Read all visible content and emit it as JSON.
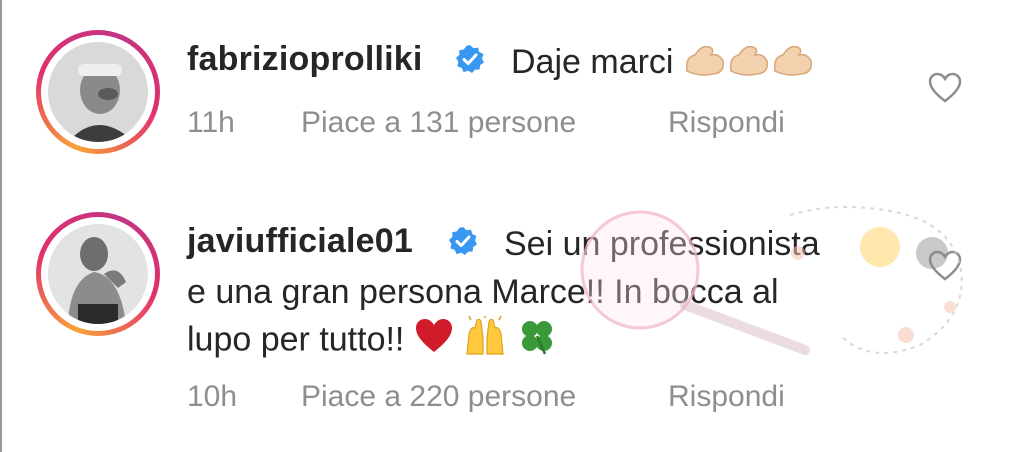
{
  "comments": [
    {
      "username": "fabrizioprolliki",
      "verified": true,
      "text": "Daje marci",
      "emojis": [
        "flexed-biceps-emoji",
        "flexed-biceps-emoji",
        "flexed-biceps-emoji"
      ],
      "time": "11h",
      "likes": "Piace a 131 persone",
      "reply": "Rispondi"
    },
    {
      "username": "javiufficiale01",
      "verified": true,
      "text_line1": "Sei un professionista",
      "text_line2": "e una gran persona Marce!! In bocca al",
      "text_line3": "lupo per tutto!!",
      "emojis": [
        "red-heart-emoji",
        "raising-hands-emoji",
        "four-leaf-clover-emoji"
      ],
      "time": "10h",
      "likes": "Piace a 220 persone",
      "reply": "Rispondi"
    }
  ],
  "colors": {
    "text": "#262626",
    "meta": "#8e8e8e",
    "verified": "#3897f0",
    "ring_start": "#f9a23a",
    "ring_end": "#c13584"
  }
}
